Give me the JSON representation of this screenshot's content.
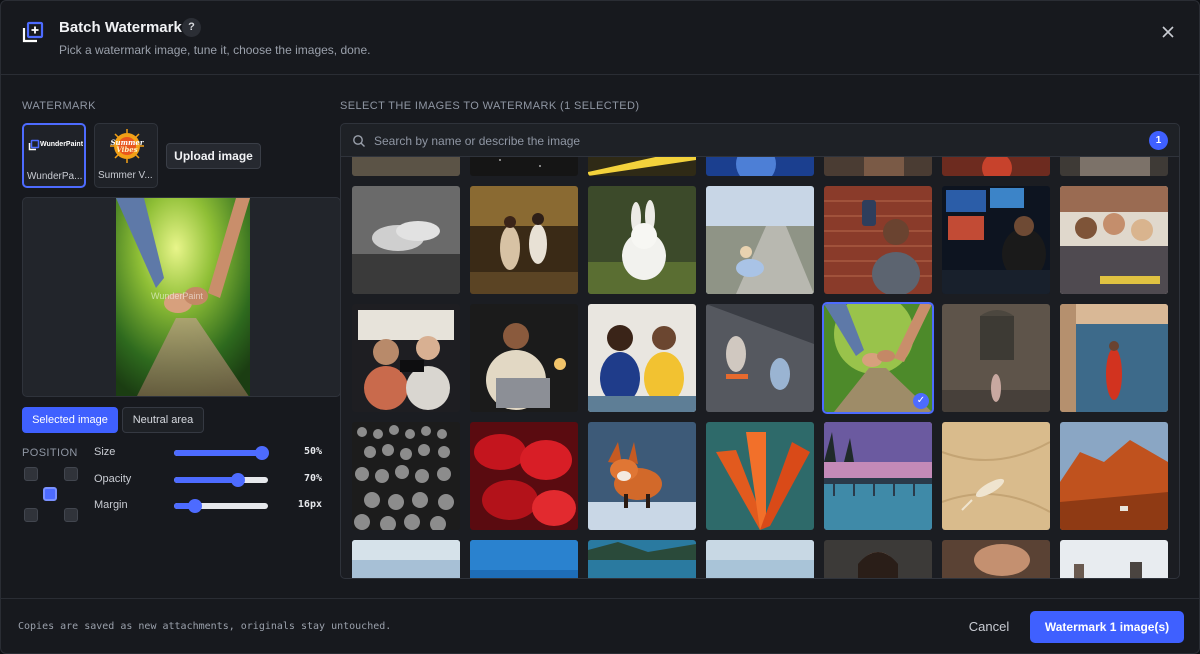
{
  "header": {
    "title": "Batch Watermark",
    "help_label": "?",
    "subtitle": "Pick a watermark image, tune it, choose the images, done."
  },
  "watermark_panel": {
    "section_label": "WATERMARK",
    "thumbnails": [
      {
        "name": "WunderPa...",
        "logo_text": "WunderPaint",
        "selected": true
      },
      {
        "name": "Summer V...",
        "logo_text": "Summer Vibes",
        "selected": false
      }
    ],
    "upload_label": "Upload image",
    "preview": {
      "watermark_text": "WunderPaint"
    },
    "preview_tabs": [
      {
        "label": "Selected image",
        "active": true
      },
      {
        "label": "Neutral area",
        "active": false
      }
    ],
    "position": {
      "label": "POSITION",
      "selected": "center"
    },
    "sliders": [
      {
        "label": "Size",
        "value_text": "50%",
        "fraction": 0.94
      },
      {
        "label": "Opacity",
        "value_text": "70%",
        "fraction": 0.68
      },
      {
        "label": "Margin",
        "value_text": "16px",
        "fraction": 0.22
      }
    ]
  },
  "images_panel": {
    "section_label": "SELECT THE IMAGES TO WATERMARK (1 SELECTED)",
    "search_placeholder": "Search by name or describe the image",
    "selected_count": "1",
    "check_glyph": "✓",
    "tiles": [
      {
        "subject": "partial-top-1",
        "selected": false
      },
      {
        "subject": "partial-top-2",
        "selected": false
      },
      {
        "subject": "partial-top-3",
        "selected": false
      },
      {
        "subject": "partial-top-4",
        "selected": false
      },
      {
        "subject": "partial-top-5",
        "selected": false
      },
      {
        "subject": "partial-top-6",
        "selected": false
      },
      {
        "subject": "partial-top-7",
        "selected": false
      },
      {
        "subject": "holding-hands-bw",
        "selected": false
      },
      {
        "subject": "dancing-couple",
        "selected": false
      },
      {
        "subject": "white-rabbit",
        "selected": false
      },
      {
        "subject": "woman-on-road",
        "selected": false
      },
      {
        "subject": "selfie-brick-wall",
        "selected": false
      },
      {
        "subject": "man-at-computer",
        "selected": false
      },
      {
        "subject": "group-selfie",
        "selected": false
      },
      {
        "subject": "friends-in-car",
        "selected": false
      },
      {
        "subject": "woman-with-laptop",
        "selected": false
      },
      {
        "subject": "friends-on-bench",
        "selected": false
      },
      {
        "subject": "skaters",
        "selected": false
      },
      {
        "subject": "holding-hands-path",
        "selected": true
      },
      {
        "subject": "woman-by-wall",
        "selected": false
      },
      {
        "subject": "woman-red-dress",
        "selected": false
      },
      {
        "subject": "crowd",
        "selected": false
      },
      {
        "subject": "red-petals",
        "selected": false
      },
      {
        "subject": "fox",
        "selected": false
      },
      {
        "subject": "orange-flower",
        "selected": false
      },
      {
        "subject": "pier-sunset",
        "selected": false
      },
      {
        "subject": "lizard-sand",
        "selected": false
      },
      {
        "subject": "red-rocks",
        "selected": false
      },
      {
        "subject": "partial-bottom-1",
        "selected": false
      },
      {
        "subject": "partial-bottom-2",
        "selected": false
      },
      {
        "subject": "partial-bottom-3",
        "selected": false
      },
      {
        "subject": "partial-bottom-4",
        "selected": false
      },
      {
        "subject": "partial-bottom-5",
        "selected": false
      },
      {
        "subject": "partial-bottom-6",
        "selected": false
      },
      {
        "subject": "partial-bottom-7",
        "selected": false
      }
    ]
  },
  "footer": {
    "note": "Copies are saved as new attachments, originals stay untouched.",
    "cancel_label": "Cancel",
    "primary_label": "Watermark 1 image(s)"
  },
  "colors": {
    "accent": "#3f60ff",
    "background": "#17191e",
    "border": "#2a2d34"
  }
}
